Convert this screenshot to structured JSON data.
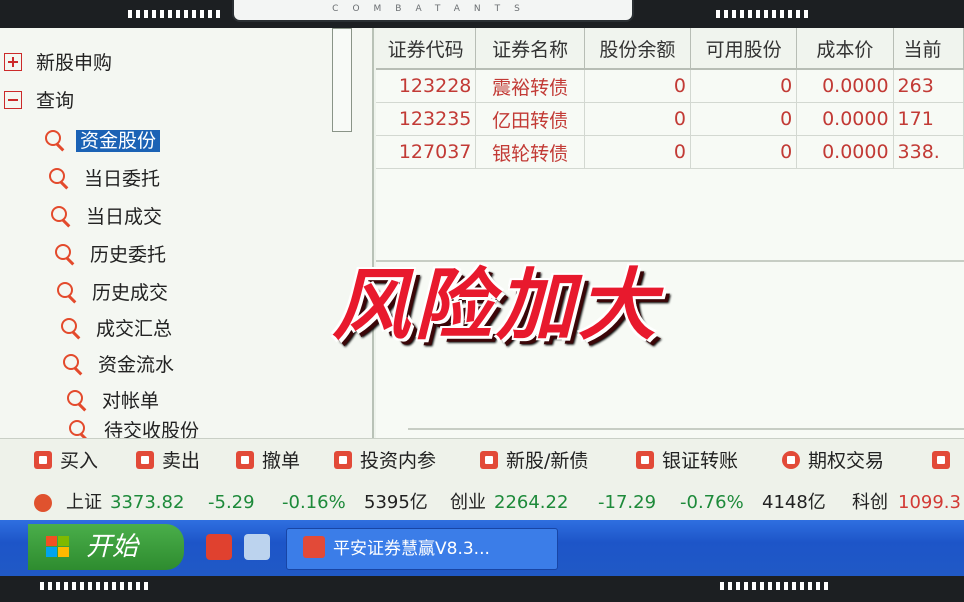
{
  "frame": {
    "banner_text": "COMBATANTS"
  },
  "tree": {
    "items": [
      {
        "label": "新股申购",
        "type": "plus"
      },
      {
        "label": "查询",
        "type": "minus"
      },
      {
        "label": "资金股份",
        "type": "query",
        "selected": true
      },
      {
        "label": "当日委托",
        "type": "query"
      },
      {
        "label": "当日成交",
        "type": "query"
      },
      {
        "label": "历史委托",
        "type": "query"
      },
      {
        "label": "历史成交",
        "type": "query"
      },
      {
        "label": "成交汇总",
        "type": "query"
      },
      {
        "label": "资金流水",
        "type": "query"
      },
      {
        "label": "对帐单",
        "type": "query"
      },
      {
        "label": "待交收股份",
        "type": "query"
      }
    ]
  },
  "grid": {
    "columns": [
      "证券代码",
      "证券名称",
      "股份余额",
      "可用股份",
      "成本价",
      "当前"
    ],
    "rows": [
      [
        "123228",
        "震裕转债",
        "0",
        "0",
        "0.0000",
        "263"
      ],
      [
        "123235",
        "亿田转债",
        "0",
        "0",
        "0.0000",
        "171"
      ],
      [
        "127037",
        "银轮转债",
        "0",
        "0",
        "0.0000",
        "338."
      ]
    ]
  },
  "toolbar": {
    "items": [
      "买入",
      "卖出",
      "撤单",
      "投资内参",
      "新股/新债",
      "银证转账",
      "期权交易"
    ]
  },
  "ticker": {
    "sh_label": "上证",
    "sh_value": "3373.82",
    "sh_change": "-5.29",
    "sh_pct": "-0.16%",
    "sh_volume": "5395亿",
    "cy_label": "创业",
    "cy_value": "2264.22",
    "cy_change": "-17.29",
    "cy_pct": "-0.76%",
    "cy_volume": "4148亿",
    "kc_label": "科创",
    "kc_value": "1099.3"
  },
  "taskbar": {
    "start_label": "开始",
    "task_label": "平安证券慧赢V8.3..."
  },
  "overlay": {
    "caption": "风险加大"
  },
  "colors": {
    "up": "#d23a35",
    "down": "#1d8a3a",
    "selection": "#1b62b5",
    "taskbar": "#2059c6",
    "start": "#2e8c2f"
  }
}
